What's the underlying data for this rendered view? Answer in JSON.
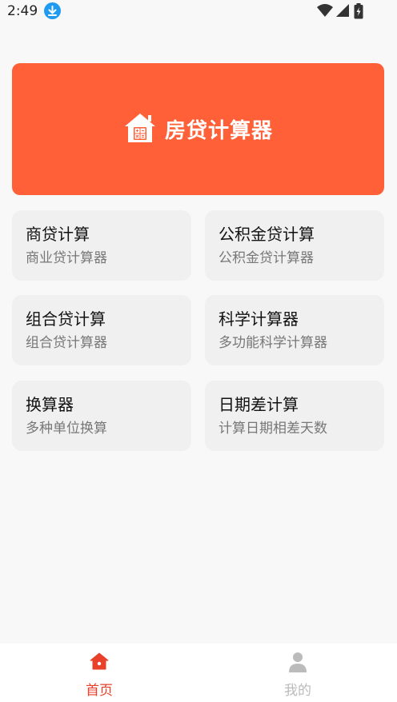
{
  "status_bar": {
    "time": "2:49"
  },
  "banner": {
    "title": "房贷计算器",
    "icon": "house-calculator-icon"
  },
  "cards": [
    {
      "title": "商贷计算",
      "subtitle": "商业贷计算器"
    },
    {
      "title": "公积金贷计算",
      "subtitle": "公积金贷计算器"
    },
    {
      "title": "组合贷计算",
      "subtitle": "组合贷计算器"
    },
    {
      "title": "科学计算器",
      "subtitle": "多功能科学计算器"
    },
    {
      "title": "换算器",
      "subtitle": "多种单位换算"
    },
    {
      "title": "日期差计算",
      "subtitle": "计算日期相差天数"
    }
  ],
  "tabs": [
    {
      "label": "首页",
      "icon": "home-icon",
      "active": true
    },
    {
      "label": "我的",
      "icon": "user-icon",
      "active": false
    }
  ],
  "colors": {
    "accent": "#ff6038",
    "tab_active": "#e8402a",
    "tab_inactive": "#bbbbbb"
  }
}
